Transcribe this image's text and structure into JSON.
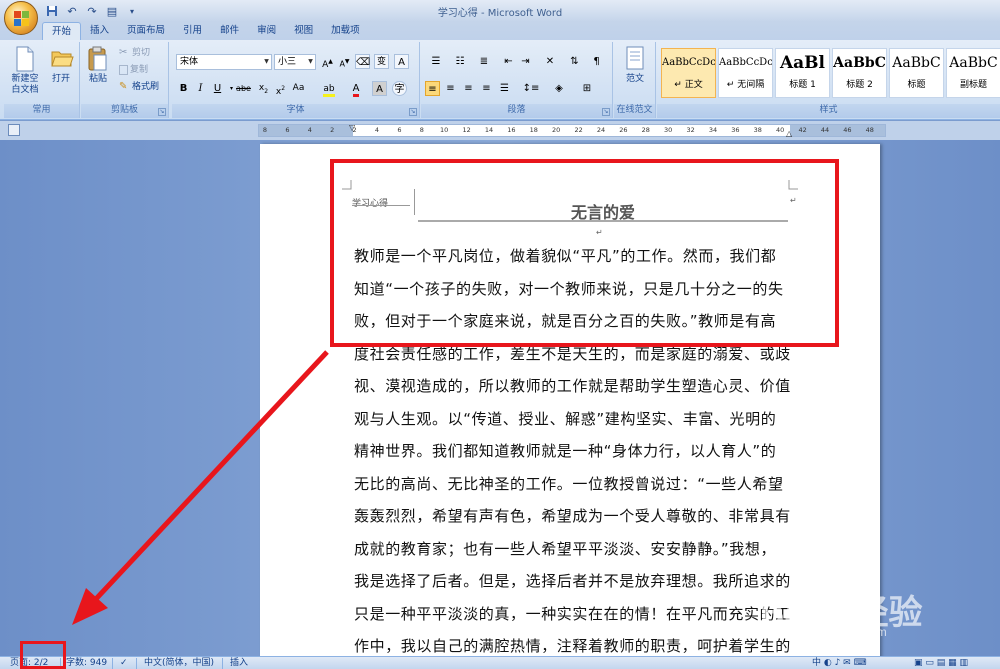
{
  "window": {
    "title": "学习心得 - Microsoft Word"
  },
  "tabs": [
    "开始",
    "插入",
    "页面布局",
    "引用",
    "邮件",
    "审阅",
    "视图",
    "加载项"
  ],
  "ribbon": {
    "clipboard": {
      "new_doc": "新建空白文档",
      "open": "打开",
      "paste": "粘贴",
      "cut": "剪切",
      "copy": "复制",
      "format_painter": "格式刷",
      "label_common": "常用",
      "label_clipboard": "剪贴板"
    },
    "font": {
      "font_name": "宋体",
      "font_size": "小三",
      "label": "字体"
    },
    "paragraph": {
      "label": "段落"
    },
    "template": {
      "button": "范文",
      "label": "在线范文"
    },
    "styles": {
      "label": "样式",
      "items": [
        {
          "sample": "AaBbCcDc",
          "name": "↵ 正文"
        },
        {
          "sample": "AaBbCcDc",
          "name": "↵ 无间隔"
        },
        {
          "sample": "AaBl",
          "name": "标题 1"
        },
        {
          "sample": "AaBbC",
          "name": "标题 2"
        },
        {
          "sample": "AaBbC",
          "name": "标题"
        },
        {
          "sample": "AaBbC",
          "name": "副标题"
        }
      ]
    }
  },
  "ruler": {
    "ticks": [
      "8",
      "6",
      "4",
      "2",
      "2",
      "4",
      "6",
      "8",
      "10",
      "12",
      "14",
      "16",
      "18",
      "20",
      "22",
      "24",
      "26",
      "28",
      "30",
      "32",
      "34",
      "36",
      "38",
      "40",
      "42",
      "44",
      "46",
      "48"
    ]
  },
  "document": {
    "header_tag": "学习心得",
    "title": "无言的爱",
    "lines": [
      "教师是一个平凡岗位，做着貌似“平凡”的工作。然而，我们都",
      "知道“一个孩子的失败，对一个教师来说，只是几十分之一的失",
      "败，但对于一个家庭来说，就是百分之百的失败。”教师是有高",
      "度社会责任感的工作，差生不是天生的，而是家庭的溺爱、或歧",
      "视、漠视造成的，所以教师的工作就是帮助学生塑造心灵、价值",
      "观与人生观。以“传道、授业、解惑”建构坚实、丰富、光明的",
      "精神世界。我们都知道教师就是一种“身体力行，以人育人”的",
      "无比的高尚、无比神圣的工作。一位教授曾说过：“一些人希望",
      "轰轰烈烈，希望有声有色，希望成为一个受人尊敬的、非常具有",
      "成就的教育家；也有一些人希望平平淡淡、安安静静。”我想，",
      "我是选择了后者。但是，选择后者并不是放弃理想。我所追求的",
      "只是一种平平淡淡的真，一种实实在在的情！在平凡而充实的工",
      "作中，我以自己的满腔热情，注释着教师的职责，呵护着学生的"
    ]
  },
  "statusbar": {
    "page": "页面: 2/2",
    "words": "字数: 949",
    "language": "中文(简体，中国)",
    "mode": "插入"
  },
  "watermark": {
    "brand": "Baidu经验",
    "url": "jingyan.baidu.com"
  },
  "colors": {
    "annotation": "#e8161c",
    "ribbon_text": "#15428b"
  }
}
